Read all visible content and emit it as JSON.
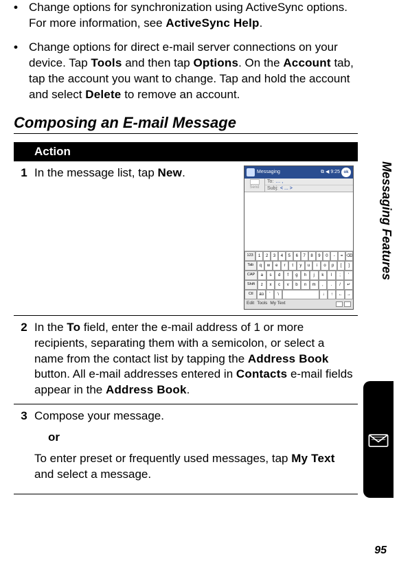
{
  "bullets": [
    {
      "pre": "Change options for synchronization using ActiveSync options. For more information, see ",
      "term1": "ActiveSync Help",
      "post": "."
    },
    {
      "parts": [
        {
          "t": "Change options for direct e-mail server connections on your device. Tap "
        },
        {
          "b": "Tools"
        },
        {
          "t": " and then tap "
        },
        {
          "b": "Options"
        },
        {
          "t": ". On the "
        },
        {
          "b": "Account"
        },
        {
          "t": " tab, tap the account you want to change. Tap and hold the account and select "
        },
        {
          "b": "Delete"
        },
        {
          "t": " to remove an account."
        }
      ]
    }
  ],
  "heading": "Composing an E-mail Message",
  "action_header": "Action",
  "steps": {
    "s1": {
      "num": "1",
      "pre": "In the message list, tap ",
      "term": "New",
      "post": "."
    },
    "s2": {
      "num": "2",
      "parts": [
        {
          "t": "In the "
        },
        {
          "b": "To"
        },
        {
          "t": " field, enter the e-mail address of 1 or more recipients, separating them with a semicolon, or select a name from the contact list by tapping the "
        },
        {
          "b": "Address Book"
        },
        {
          "t": " button. All e-mail addresses entered in "
        },
        {
          "b": "Contacts"
        },
        {
          "t": " e-mail fields appear in the "
        },
        {
          "b": "Address Book"
        },
        {
          "t": "."
        }
      ]
    },
    "s3": {
      "num": "3",
      "line1": "Compose your message.",
      "or": "or",
      "line2_pre": "To enter preset or frequently used messages, tap ",
      "line2_term": "My Text",
      "line2_post": " and select a message."
    }
  },
  "screenshot": {
    "title": "Messaging",
    "time": "9:25",
    "ok": "ok",
    "send": "Send",
    "to_label": "To:",
    "to_value": "… ,",
    "subj_label": "Subj:",
    "subj_value": "< ... >",
    "kb_rows": [
      [
        "123",
        "1",
        "2",
        "3",
        "4",
        "5",
        "6",
        "7",
        "8",
        "9",
        "0",
        "-",
        "=",
        "⌫"
      ],
      [
        "Tab",
        "q",
        "w",
        "e",
        "r",
        "t",
        "y",
        "u",
        "i",
        "o",
        "p",
        "[",
        "]"
      ],
      [
        "CAP",
        "a",
        "s",
        "d",
        "f",
        "g",
        "h",
        "j",
        "k",
        "l",
        ";",
        "'"
      ],
      [
        "Shift",
        "z",
        "x",
        "c",
        "v",
        "b",
        "n",
        "m",
        ",",
        ".",
        "/",
        "↵"
      ],
      [
        "Ctl",
        "áü",
        "`",
        "\\",
        " ",
        "↓",
        "↑",
        "←",
        "→"
      ]
    ],
    "bottom_left": [
      "Edit",
      "Tools",
      "My Text"
    ]
  },
  "side_tab": "Messaging Features",
  "page_num": "95"
}
